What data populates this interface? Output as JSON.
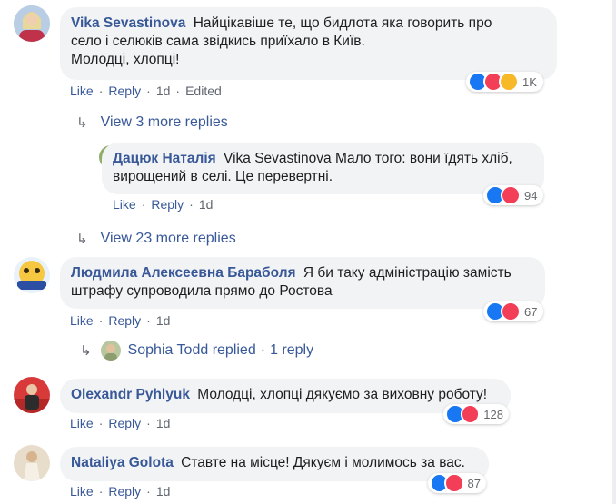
{
  "colors": {
    "link": "#385898",
    "bubble": "#f2f3f5",
    "meta": "#606770",
    "like": "#1877f2",
    "love": "#f33e58",
    "haha": "#f7b928"
  },
  "comments": [
    {
      "author": "Vika Sevastinova",
      "text_line1": "Найцікавіше те, що бидлота яка говорить про",
      "text_line2": "село і селюків сама звідкись приїхало в Київ.",
      "text_line3": "Молодці, хлопці!",
      "like": "Like",
      "reply": "Reply",
      "time": "1d",
      "edited": "Edited",
      "reaction_count": "1K",
      "reactions": [
        "like-icon",
        "love-icon",
        "haha-icon"
      ]
    },
    {
      "author": "Дацюк Наталія",
      "mention": "Vika Sevastinova",
      "text_line1": "Мало того: вони їдять хліб,",
      "text_line2": "вирощений в селі. Це перевертні.",
      "like": "Like",
      "reply": "Reply",
      "time": "1d",
      "reaction_count": "94",
      "reactions": [
        "like-icon",
        "love-icon"
      ]
    },
    {
      "author": "Людмила Алексеевна Бараболя",
      "text_line1": "Я би таку адміністрацію замість",
      "text_line2": "штрафу супроводила прямо до Ростова",
      "like": "Like",
      "reply": "Reply",
      "time": "1d",
      "reaction_count": "67",
      "reactions": [
        "like-icon",
        "love-icon"
      ]
    },
    {
      "author": "Olexandr Pyhlyuk",
      "text_line1": "Молодці, хлопці дякуємо за виховну роботу!",
      "like": "Like",
      "reply": "Reply",
      "time": "1d",
      "reaction_count": "128",
      "reactions": [
        "like-icon",
        "love-icon"
      ]
    },
    {
      "author": "Nataliya Golota",
      "text_line1": "Ставте на місце! Дякуєм і молимось за вас.",
      "like": "Like",
      "reply": "Reply",
      "time": "1d",
      "reaction_count": "87",
      "reactions": [
        "like-icon",
        "love-icon"
      ]
    }
  ],
  "more_replies": {
    "first": "View 3 more replies",
    "second": "View 23 more replies",
    "replied_user": "Sophia Todd replied",
    "replied_count": "1 reply"
  }
}
